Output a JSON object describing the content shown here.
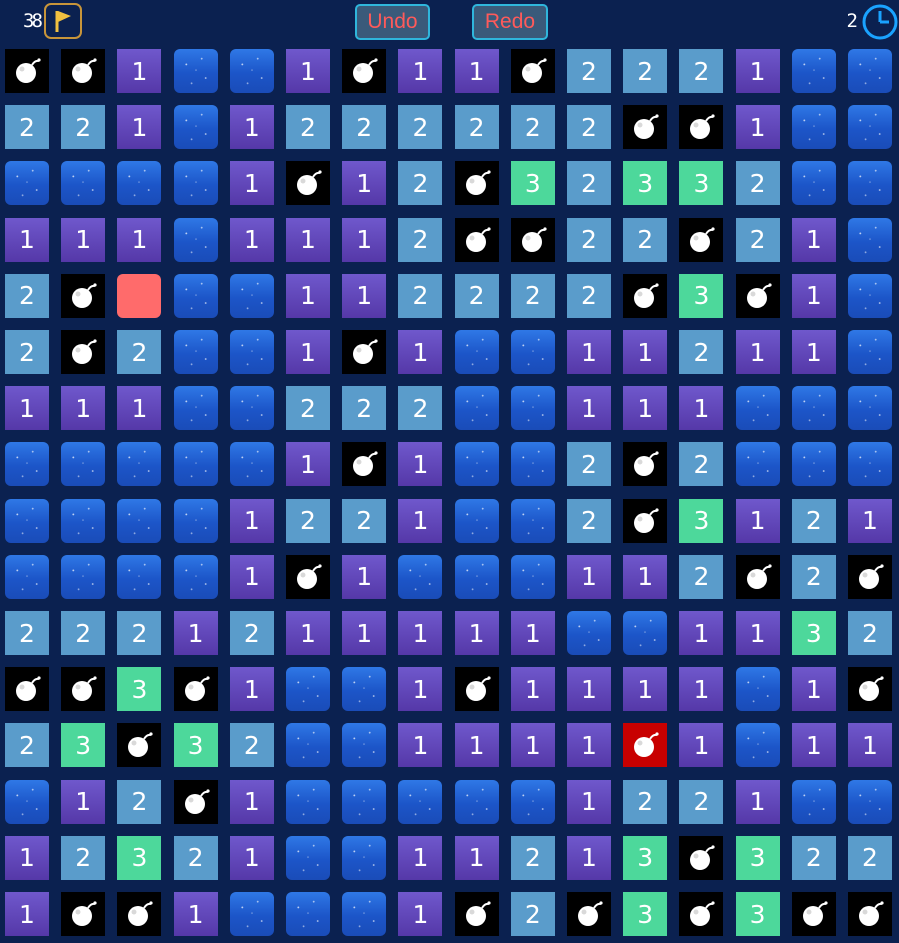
{
  "header": {
    "flags_remaining": "38",
    "timer": "2",
    "undo_label": "Undo",
    "redo_label": "Redo",
    "flag_icon": "flag-icon",
    "clock_icon": "clock-icon"
  },
  "colors": {
    "background": "#0b2150",
    "hidden": "#1c55c8",
    "one": "#5538a8",
    "two": "#5a9ccb",
    "three": "#4dd89b",
    "mine": "#000000",
    "mine_hit": "#c80000",
    "marked": "#ff6b6b",
    "button_text": "#ff5a5a",
    "button_border": "#2fb6dc"
  },
  "legend": {
    "H": "hidden",
    "M": "mine",
    "X": "mine-hit",
    "R": "marked",
    "1": "one",
    "2": "two",
    "3": "three"
  },
  "board": {
    "rows": 16,
    "cols": 16,
    "cells": [
      [
        "M",
        "M",
        "1",
        "H",
        "H",
        "1",
        "M",
        "1",
        "1",
        "M",
        "2",
        "2",
        "2",
        "1",
        "H",
        "H"
      ],
      [
        "2",
        "2",
        "1",
        "H",
        "1",
        "2",
        "2",
        "2",
        "2",
        "2",
        "2",
        "M",
        "M",
        "1",
        "H",
        "H"
      ],
      [
        "H",
        "H",
        "H",
        "H",
        "1",
        "M",
        "1",
        "2",
        "M",
        "3",
        "2",
        "3",
        "3",
        "2",
        "H",
        "H"
      ],
      [
        "1",
        "1",
        "1",
        "H",
        "1",
        "1",
        "1",
        "2",
        "M",
        "M",
        "2",
        "2",
        "M",
        "2",
        "1",
        "H"
      ],
      [
        "2",
        "M",
        "R",
        "H",
        "H",
        "1",
        "1",
        "2",
        "2",
        "2",
        "2",
        "M",
        "3",
        "M",
        "1",
        "H"
      ],
      [
        "2",
        "M",
        "2",
        "H",
        "H",
        "1",
        "M",
        "1",
        "H",
        "H",
        "1",
        "1",
        "2",
        "1",
        "1",
        "H"
      ],
      [
        "1",
        "1",
        "1",
        "H",
        "H",
        "2",
        "2",
        "2",
        "H",
        "H",
        "1",
        "1",
        "1",
        "H",
        "H",
        "H"
      ],
      [
        "H",
        "H",
        "H",
        "H",
        "H",
        "1",
        "M",
        "1",
        "H",
        "H",
        "2",
        "M",
        "2",
        "H",
        "H",
        "H"
      ],
      [
        "H",
        "H",
        "H",
        "H",
        "1",
        "2",
        "2",
        "1",
        "H",
        "H",
        "2",
        "M",
        "3",
        "1",
        "2",
        "1"
      ],
      [
        "H",
        "H",
        "H",
        "H",
        "1",
        "M",
        "1",
        "H",
        "H",
        "H",
        "1",
        "1",
        "2",
        "M",
        "2",
        "M"
      ],
      [
        "2",
        "2",
        "2",
        "1",
        "2",
        "1",
        "1",
        "1",
        "1",
        "1",
        "H",
        "H",
        "1",
        "1",
        "3",
        "2"
      ],
      [
        "M",
        "M",
        "3",
        "M",
        "1",
        "H",
        "H",
        "1",
        "M",
        "1",
        "1",
        "1",
        "1",
        "H",
        "1",
        "M"
      ],
      [
        "2",
        "3",
        "M",
        "3",
        "2",
        "H",
        "H",
        "1",
        "1",
        "1",
        "1",
        "X",
        "1",
        "H",
        "1",
        "1"
      ],
      [
        "H",
        "1",
        "2",
        "M",
        "1",
        "H",
        "H",
        "H",
        "H",
        "H",
        "1",
        "2",
        "2",
        "1",
        "H",
        "H"
      ],
      [
        "1",
        "2",
        "3",
        "2",
        "1",
        "H",
        "H",
        "1",
        "1",
        "2",
        "1",
        "3",
        "M",
        "3",
        "2",
        "2"
      ],
      [
        "1",
        "M",
        "M",
        "1",
        "H",
        "H",
        "H",
        "1",
        "M",
        "2",
        "M",
        "3",
        "M",
        "3",
        "M",
        "M"
      ]
    ]
  }
}
